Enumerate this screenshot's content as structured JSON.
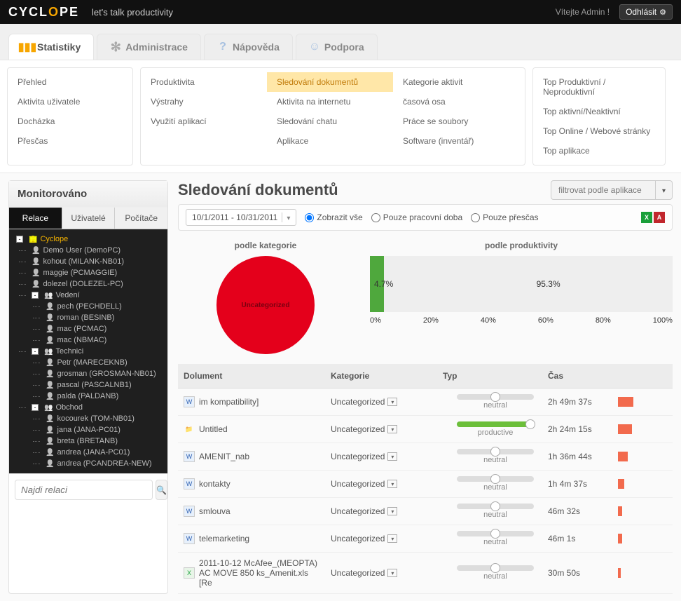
{
  "header": {
    "brand_pre": "CYCL",
    "brand_o": "O",
    "brand_post": "PE",
    "tagline": "let's talk productivity",
    "welcome": "Vítejte Admin !",
    "logout": "Odhlásit"
  },
  "tabs": {
    "stats": "Statistiky",
    "admin": "Administrace",
    "help": "Nápověda",
    "support": "Podpora"
  },
  "submenu": {
    "col_a": [
      "Přehled",
      "Aktivita uživatele",
      "Docházka",
      "Přesčas"
    ],
    "col_b": [
      "Produktivita",
      "Výstrahy",
      "Využití aplikací"
    ],
    "col_c": [
      "Sledování dokumentů",
      "Aktivita na internetu",
      "Sledování chatu",
      "Aplikace"
    ],
    "col_d": [
      "Kategorie aktivit",
      "časová osa",
      "Práce se soubory",
      "Software (inventář)"
    ],
    "col_e": [
      "Top Produktivní / Neproduktivní",
      "Top aktivní/Neaktivní",
      "Top Online / Webové stránky",
      "Top aplikace"
    ]
  },
  "sidebar": {
    "title": "Monitorováno",
    "tabs": {
      "sessions": "Relace",
      "users": "Uživatelé",
      "computers": "Počítače"
    },
    "search_placeholder": "Najdi relaci"
  },
  "tree": [
    {
      "level": 1,
      "type": "root",
      "toggle": "-",
      "label": "Cyclope"
    },
    {
      "level": 2,
      "type": "user",
      "label": "Demo User (DemoPC)"
    },
    {
      "level": 2,
      "type": "user",
      "label": "kohout (MILANK-NB01)"
    },
    {
      "level": 2,
      "type": "user",
      "label": "maggie (PCMAGGIE)"
    },
    {
      "level": 2,
      "type": "user",
      "label": "dolezel (DOLEZEL-PC)"
    },
    {
      "level": 2,
      "type": "group",
      "toggle": "-",
      "label": "Vedení"
    },
    {
      "level": 3,
      "type": "user",
      "label": "pech (PECHDELL)"
    },
    {
      "level": 3,
      "type": "user",
      "label": "roman (BESINB)"
    },
    {
      "level": 3,
      "type": "user",
      "label": "mac (PCMAC)"
    },
    {
      "level": 3,
      "type": "user",
      "label": "mac (NBMAC)"
    },
    {
      "level": 2,
      "type": "group",
      "toggle": "-",
      "label": "Technici"
    },
    {
      "level": 3,
      "type": "user",
      "label": "Petr (MARECEKNB)"
    },
    {
      "level": 3,
      "type": "user",
      "label": "grosman (GROSMAN-NB01)"
    },
    {
      "level": 3,
      "type": "user",
      "label": "pascal (PASCALNB1)"
    },
    {
      "level": 3,
      "type": "user",
      "label": "palda (PALDANB)"
    },
    {
      "level": 2,
      "type": "group",
      "toggle": "-",
      "label": "Obchod"
    },
    {
      "level": 3,
      "type": "user",
      "label": "kocourek (TOM-NB01)"
    },
    {
      "level": 3,
      "type": "user",
      "label": "jana (JANA-PC01)"
    },
    {
      "level": 3,
      "type": "user",
      "label": "breta (BRETANB)"
    },
    {
      "level": 3,
      "type": "user",
      "label": "andrea (JANA-PC01)"
    },
    {
      "level": 3,
      "type": "user",
      "label": "andrea (PCANDREA-NEW)"
    }
  ],
  "page": {
    "title": "Sledování dokumentů",
    "filter_placeholder": "filtrovat podle aplikace",
    "daterange": "10/1/2011 - 10/31/2011",
    "radios": {
      "all": "Zobrazit vše",
      "work": "Pouze pracovní doba",
      "overtime": "Pouze přesčas"
    }
  },
  "chart_data": [
    {
      "type": "pie",
      "title": "podle kategorie",
      "series": [
        {
          "name": "Uncategorized",
          "value": 100
        }
      ]
    },
    {
      "type": "bar",
      "title": "podle produktivity",
      "orientation": "horizontal-stacked",
      "categories": [
        ""
      ],
      "series": [
        {
          "name": "productive",
          "values": [
            4.7
          ],
          "color": "#4fa83d"
        },
        {
          "name": "neutral",
          "values": [
            95.3
          ],
          "color": "#dddddd"
        }
      ],
      "value_labels": [
        "4.7%",
        "95.3%"
      ],
      "xlabel": "",
      "ylabel": "",
      "xlim": [
        0,
        100
      ],
      "ticks": [
        "0%",
        "20%",
        "40%",
        "60%",
        "80%",
        "100%"
      ]
    }
  ],
  "charts": {
    "pie_title": "podle kategorie",
    "pie_label": "Uncategorized",
    "bar_title": "podle produktivity",
    "green_pct": 4.7,
    "green_label": "4.7%",
    "grey_label": "95.3%",
    "axis": [
      "0%",
      "20%",
      "40%",
      "60%",
      "80%",
      "100%"
    ]
  },
  "table": {
    "headers": {
      "doc": "Dolument",
      "cat": "Kategorie",
      "type": "Typ",
      "time": "Čas"
    },
    "category_value": "Uncategorized",
    "rows": [
      {
        "icon": "word",
        "name": "im kompatibility]",
        "type": "neutral",
        "time": "2h 49m 37s",
        "bar": 22
      },
      {
        "icon": "fold",
        "name": "Untitled",
        "type": "productive",
        "time": "2h 24m 15s",
        "bar": 20
      },
      {
        "icon": "word",
        "name": "AMENIT_nab",
        "type": "neutral",
        "time": "1h 36m 44s",
        "bar": 14
      },
      {
        "icon": "word",
        "name": "kontakty",
        "type": "neutral",
        "time": "1h 4m 37s",
        "bar": 9
      },
      {
        "icon": "word",
        "name": "smlouva",
        "type": "neutral",
        "time": "46m 32s",
        "bar": 6
      },
      {
        "icon": "word",
        "name": "telemarketing",
        "type": "neutral",
        "time": "46m 1s",
        "bar": 6
      },
      {
        "icon": "xls",
        "name": "2011-10-12 McAfee_(MEOPTA) AC MOVE 850 ks_Amenit.xls                  [Re",
        "type": "neutral",
        "time": "30m 50s",
        "bar": 4
      }
    ]
  }
}
